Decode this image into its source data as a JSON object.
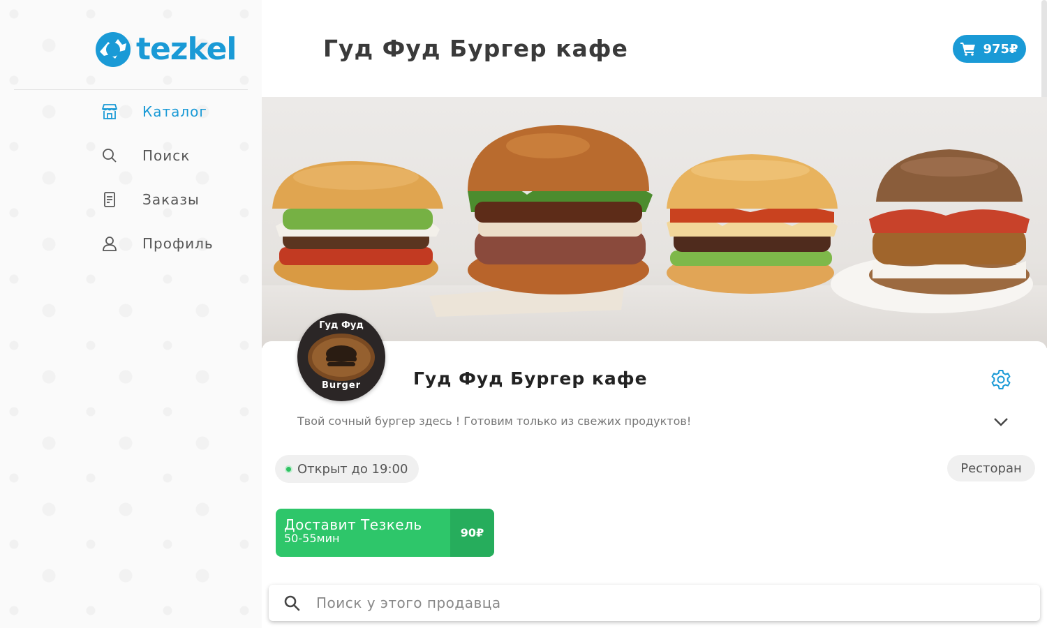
{
  "brand": {
    "name": "tezkel",
    "color": "#1a9ad6"
  },
  "sidebar": {
    "items": [
      {
        "label": "Каталог",
        "icon": "store-icon",
        "active": true
      },
      {
        "label": "Поиск",
        "icon": "search-icon",
        "active": false
      },
      {
        "label": "Заказы",
        "icon": "orders-icon",
        "active": false
      },
      {
        "label": "Профиль",
        "icon": "profile-icon",
        "active": false
      }
    ]
  },
  "header": {
    "title": "Гуд Фуд Бургер кафе",
    "cart": {
      "icon": "cart-icon",
      "amount": "975₽"
    }
  },
  "shop": {
    "name": "Гуд Фуд Бургер кафе",
    "logo_text_top": "Гуд Фуд",
    "logo_text_bottom": "Burger",
    "description": "Твой сочный бургер здесь ! Готовим только из свежих продуктов!",
    "status": "Открыт до 19:00",
    "category": "Ресторан",
    "delivery": {
      "title": "Доставит Тезкель",
      "time": "50-55мин",
      "price": "90₽"
    }
  },
  "search": {
    "placeholder": "Поиск у этого продавца",
    "value": ""
  },
  "colors": {
    "accent": "#1a9ad6",
    "green": "#2ec66a",
    "status_green": "#2ec262"
  }
}
